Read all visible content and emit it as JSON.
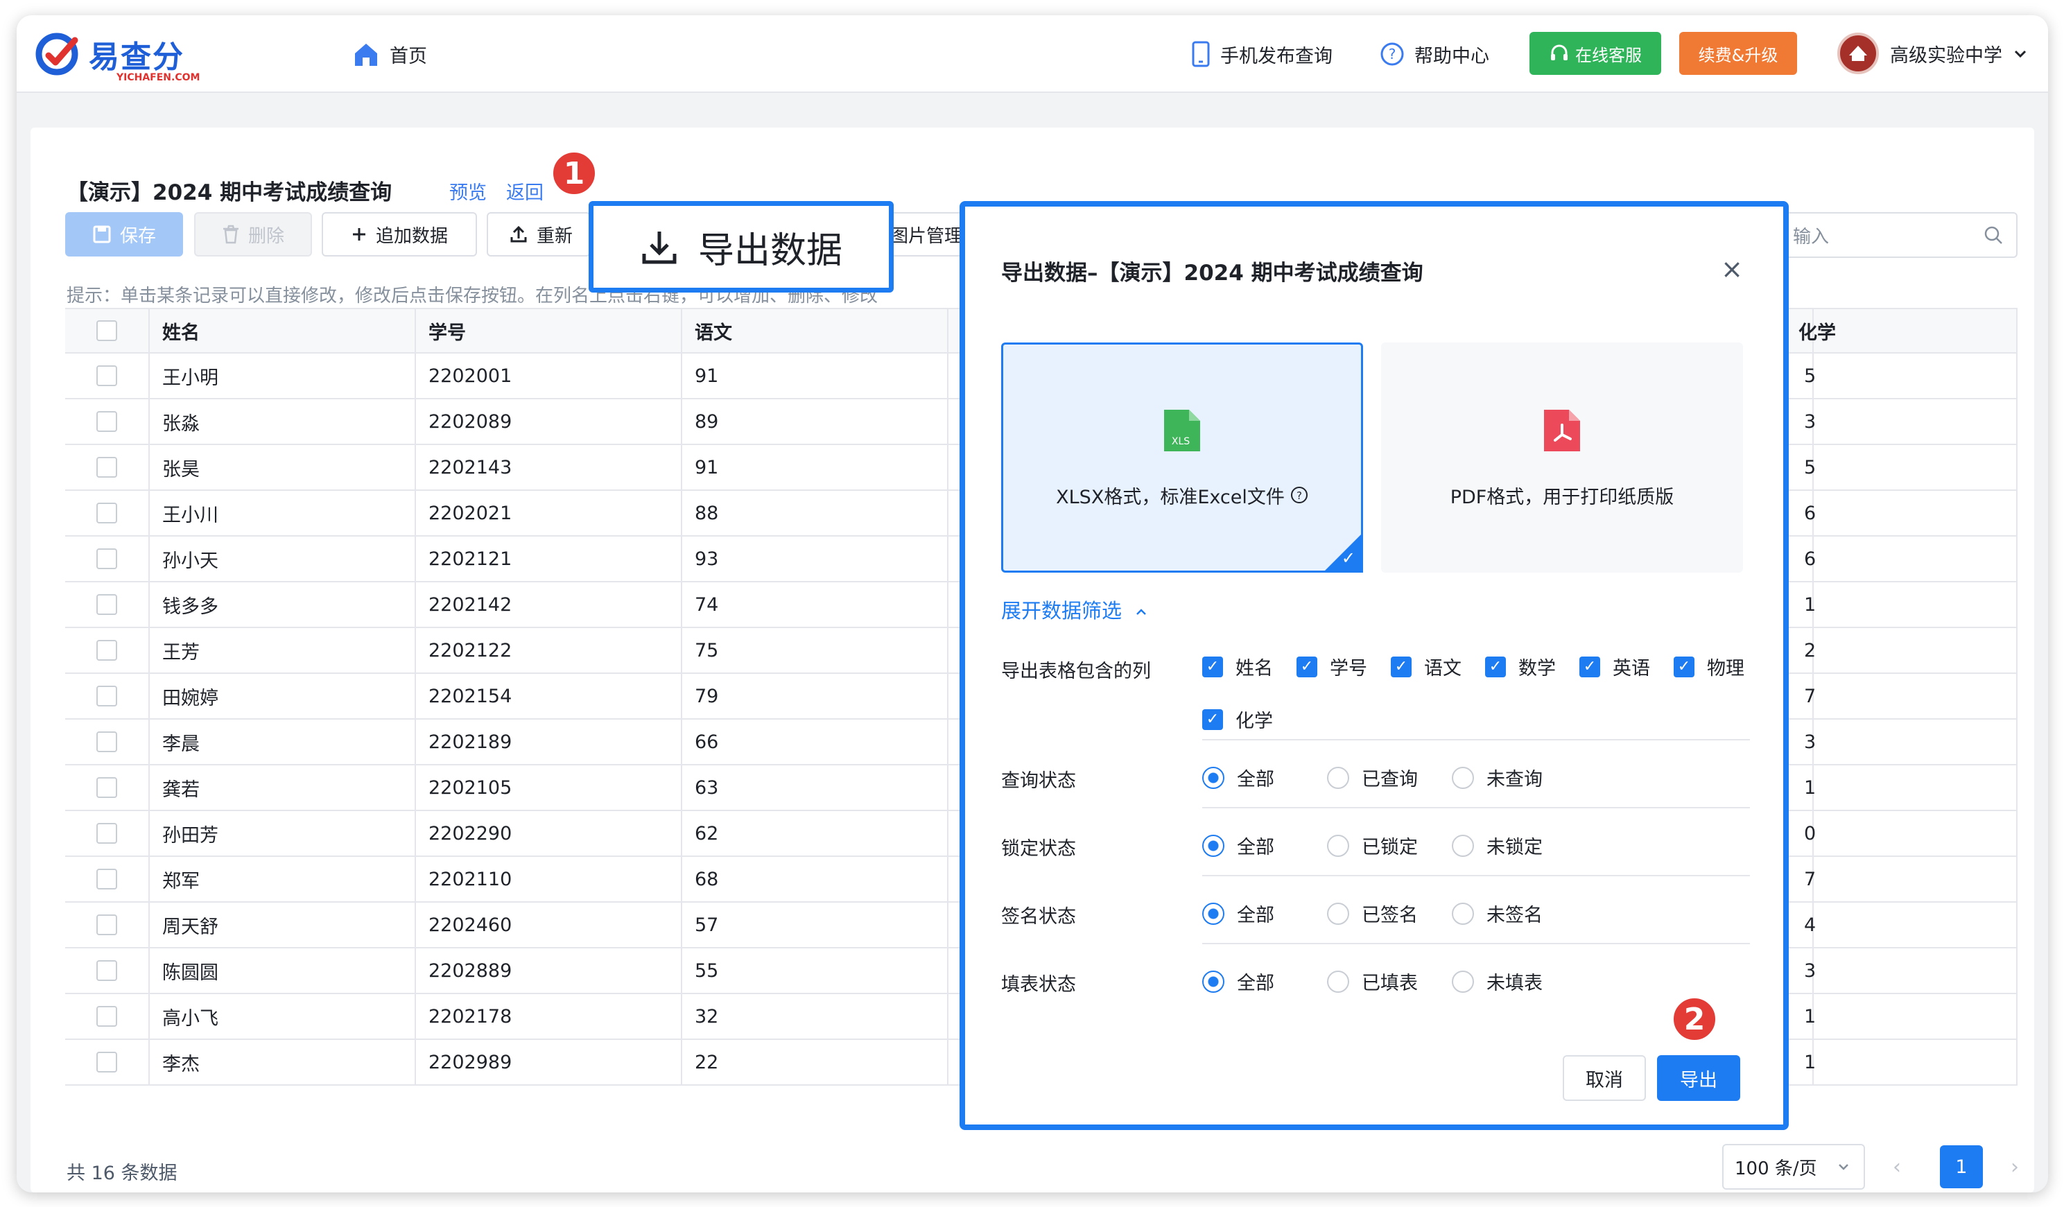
{
  "header": {
    "logo_text": "易查分",
    "logo_sub": "YICHAFEN.COM",
    "home": "首页",
    "mobile_publish": "手机发布查询",
    "help_center": "帮助中心",
    "online_service": "在线客服",
    "renew_upgrade": "续费&升级",
    "school_name": "高级实验中学"
  },
  "page": {
    "title": "【演示】2024 期中考试成绩查询",
    "preview_link": "预览",
    "back_link": "返回",
    "save": "保存",
    "delete": "删除",
    "add_data": "追加数据",
    "reupload": "重新",
    "image_manage": "图片管理",
    "search_placeholder": "输入",
    "hint": "提示：单击某条记录可以直接修改，修改后点击保存按钮。在列名上点击右键，可以增加、删除、修改"
  },
  "table": {
    "headers": [
      "姓名",
      "学号",
      "语文",
      "化学"
    ],
    "rows": [
      {
        "name": "王小明",
        "id": "2202001",
        "chinese": "91",
        "chem": "5"
      },
      {
        "name": "张淼",
        "id": "2202089",
        "chinese": "89",
        "chem": "3"
      },
      {
        "name": "张昊",
        "id": "2202143",
        "chinese": "91",
        "chem": "5"
      },
      {
        "name": "王小川",
        "id": "2202021",
        "chinese": "88",
        "chem": "6"
      },
      {
        "name": "孙小天",
        "id": "2202121",
        "chinese": "93",
        "chem": "6"
      },
      {
        "name": "钱多多",
        "id": "2202142",
        "chinese": "74",
        "chem": "1"
      },
      {
        "name": "王芳",
        "id": "2202122",
        "chinese": "75",
        "chem": "2"
      },
      {
        "name": "田婉婷",
        "id": "2202154",
        "chinese": "79",
        "chem": "7"
      },
      {
        "name": "李晨",
        "id": "2202189",
        "chinese": "66",
        "chem": "3"
      },
      {
        "name": "龚若",
        "id": "2202105",
        "chinese": "63",
        "chem": "1"
      },
      {
        "name": "孙田芳",
        "id": "2202290",
        "chinese": "62",
        "chem": "0"
      },
      {
        "name": "郑军",
        "id": "2202110",
        "chinese": "68",
        "chem": "7"
      },
      {
        "name": "周天舒",
        "id": "2202460",
        "chinese": "57",
        "chem": "4"
      },
      {
        "name": "陈圆圆",
        "id": "2202889",
        "chinese": "55",
        "chem": "3"
      },
      {
        "name": "高小飞",
        "id": "2202178",
        "chinese": "32",
        "chem": "1"
      },
      {
        "name": "李杰",
        "id": "2202989",
        "chinese": "22",
        "chem": "1"
      }
    ]
  },
  "footer": {
    "count": "共 16 条数据",
    "page_size": "100 条/页",
    "current_page": "1"
  },
  "callout": {
    "export_button": "导出数据",
    "step1": "1",
    "step2": "2"
  },
  "modal": {
    "title": "导出数据–【演示】2024 期中考试成绩查询",
    "xlsx_icon_text": "XLS",
    "xlsx_label": "XLSX格式，标准Excel文件",
    "pdf_label": "PDF格式，用于打印纸质版",
    "expand_filter": "展开数据筛选",
    "columns_label": "导出表格包含的列",
    "columns": [
      "姓名",
      "学号",
      "语文",
      "数学",
      "英语",
      "物理",
      "化学"
    ],
    "query_status": {
      "label": "查询状态",
      "options": [
        "全部",
        "已查询",
        "未查询"
      ]
    },
    "lock_status": {
      "label": "锁定状态",
      "options": [
        "全部",
        "已锁定",
        "未锁定"
      ]
    },
    "sign_status": {
      "label": "签名状态",
      "options": [
        "全部",
        "已签名",
        "未签名"
      ]
    },
    "fill_status": {
      "label": "填表状态",
      "options": [
        "全部",
        "已填表",
        "未填表"
      ]
    },
    "cancel": "取消",
    "export": "导出"
  },
  "colors": {
    "primary": "#1e7cf2",
    "green": "#2fb45a",
    "orange": "#f07a34",
    "badge_red": "#e33b36"
  }
}
